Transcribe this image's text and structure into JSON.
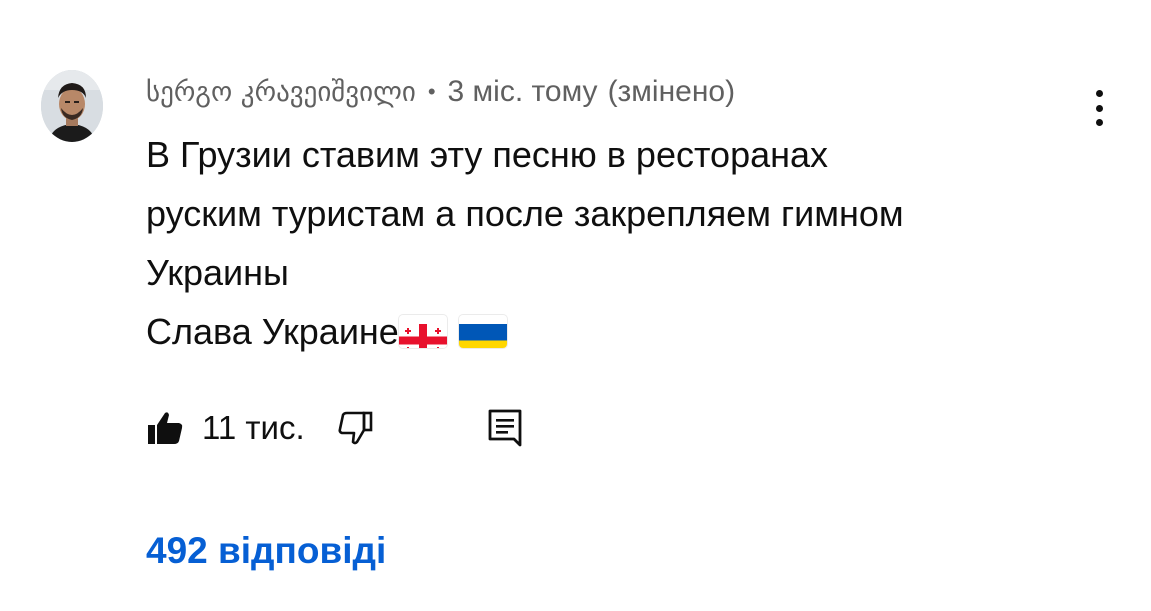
{
  "comment": {
    "author": "სერგო კრავეიშვილი",
    "separator": "•",
    "time": "3 міс. тому",
    "edited": "(змінено)",
    "text_lines": [
      "В Грузии ставим эту песню в ресторанах",
      "руским туристам а после закрепляем гимном",
      "Украины",
      "Слава Украине"
    ],
    "flags": [
      "flag-georgia-icon",
      "flag-ukraine-icon"
    ],
    "like_count": "11 тис.",
    "replies_label": "492 відповіді"
  },
  "icons": {
    "like": "thumbs-up-filled-icon",
    "dislike": "thumbs-down-outline-icon",
    "reply": "reply-comment-icon",
    "menu": "more-vertical-icon"
  },
  "colors": {
    "text": "#0f0f0f",
    "secondary": "#606060",
    "link": "#065fd4",
    "georgia_red": "#e8112d",
    "ukraine_blue": "#0057b7",
    "ukraine_yellow": "#ffd700"
  }
}
